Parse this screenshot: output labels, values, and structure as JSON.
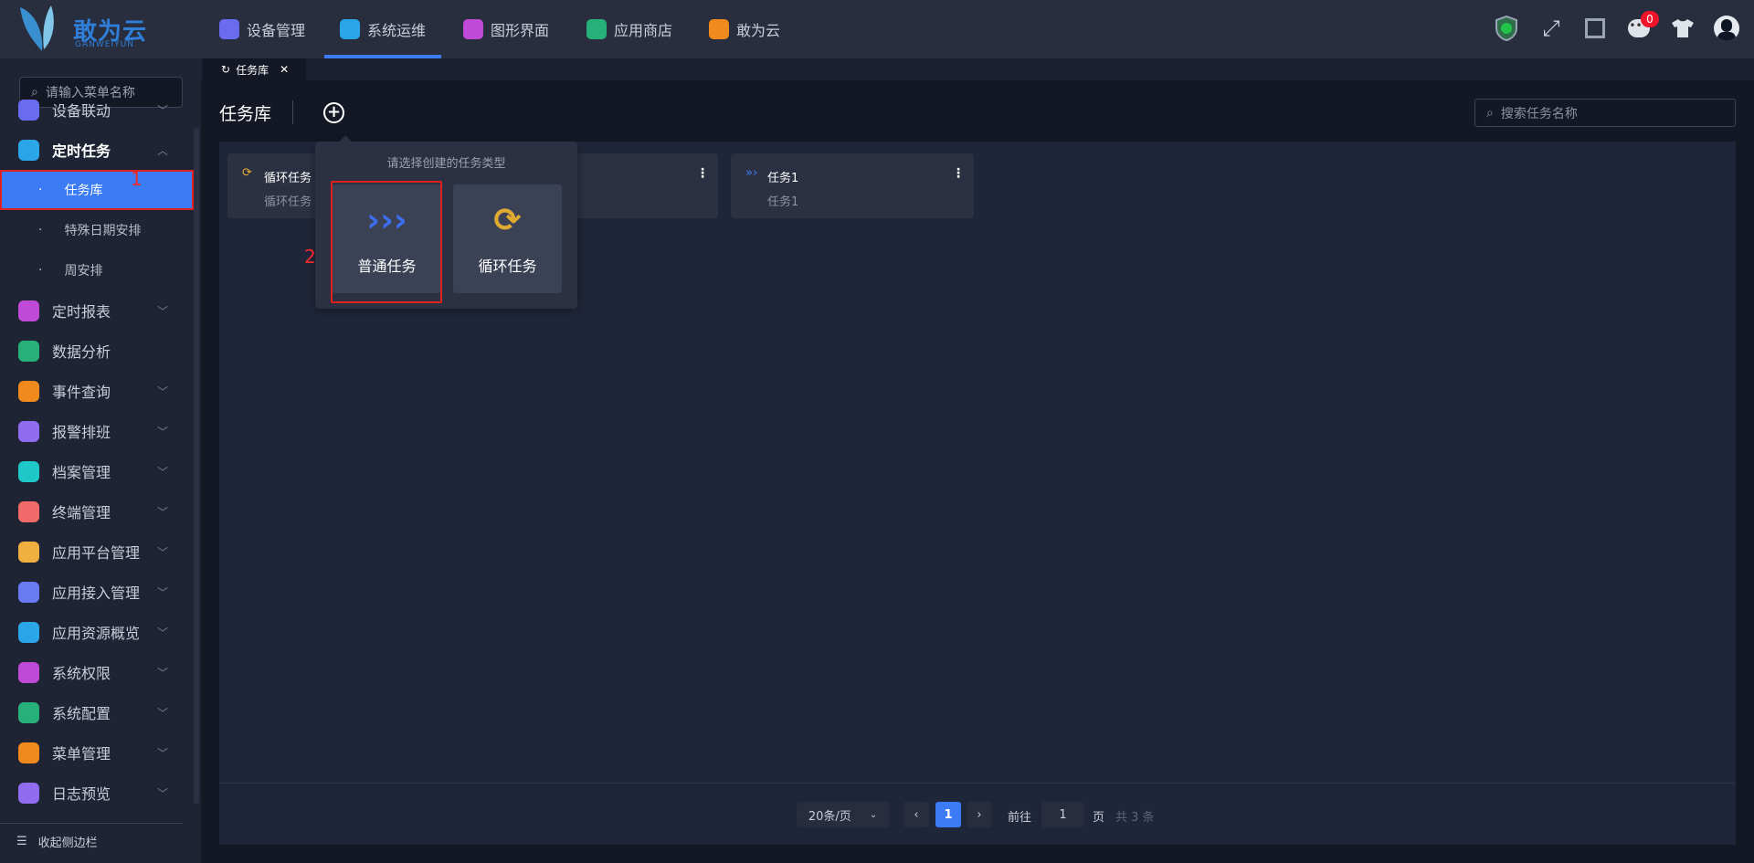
{
  "logo": {
    "text": "敢为云",
    "sub": "GANWEIYUN"
  },
  "topnav": [
    {
      "label": "设备管理",
      "color": "#6a6cf0"
    },
    {
      "label": "系统运维",
      "color": "#2aa6e8"
    },
    {
      "label": "图形界面",
      "color": "#c04ad8"
    },
    {
      "label": "应用商店",
      "color": "#28b07a"
    },
    {
      "label": "敢为云",
      "color": "#f08a1c"
    }
  ],
  "notif_count": "0",
  "tab": {
    "label": "任务库",
    "close": "✕"
  },
  "sidebar": {
    "search_placeholder": "请输入菜单名称",
    "items": [
      {
        "label": "设备联动",
        "color": "#6a6cf0"
      },
      {
        "label": "定时任务",
        "color": "#2aa6e8"
      },
      {
        "label": "定时报表",
        "color": "#c04ad8"
      },
      {
        "label": "数据分析",
        "color": "#28b07a"
      },
      {
        "label": "事件查询",
        "color": "#f08a1c"
      },
      {
        "label": "报警排班",
        "color": "#8f6cf0"
      },
      {
        "label": "档案管理",
        "color": "#1ec8c8"
      },
      {
        "label": "终端管理",
        "color": "#f06a6a"
      },
      {
        "label": "应用平台管理",
        "color": "#f0b040"
      },
      {
        "label": "应用接入管理",
        "color": "#6a7af0"
      },
      {
        "label": "应用资源概览",
        "color": "#2aa6e8"
      },
      {
        "label": "系统权限",
        "color": "#c04ad8"
      },
      {
        "label": "系统配置",
        "color": "#28b07a"
      },
      {
        "label": "菜单管理",
        "color": "#f08a1c"
      },
      {
        "label": "日志预览",
        "color": "#8f6cf0"
      }
    ],
    "subitems": [
      "任务库",
      "特殊日期安排",
      "周安排"
    ],
    "collapse": "收起侧边栏"
  },
  "annotations": {
    "step1": "1",
    "step2": "2"
  },
  "main": {
    "title": "任务库",
    "search_placeholder": "搜索任务名称",
    "cards": [
      {
        "title": "循环任务",
        "desc": "循环任务",
        "type": "loop"
      },
      {
        "title": "",
        "desc": "",
        "type": "normal"
      },
      {
        "title": "任务1",
        "desc": "任务1",
        "type": "normal"
      }
    ],
    "popover": {
      "title": "请选择创建的任务类型",
      "options": [
        "普通任务",
        "循环任务"
      ]
    }
  },
  "pagination": {
    "page_size": "20条/页",
    "current": "1",
    "goto_label": "前往",
    "goto_value": "1",
    "page_suffix": "页",
    "total": "共 3 条"
  }
}
